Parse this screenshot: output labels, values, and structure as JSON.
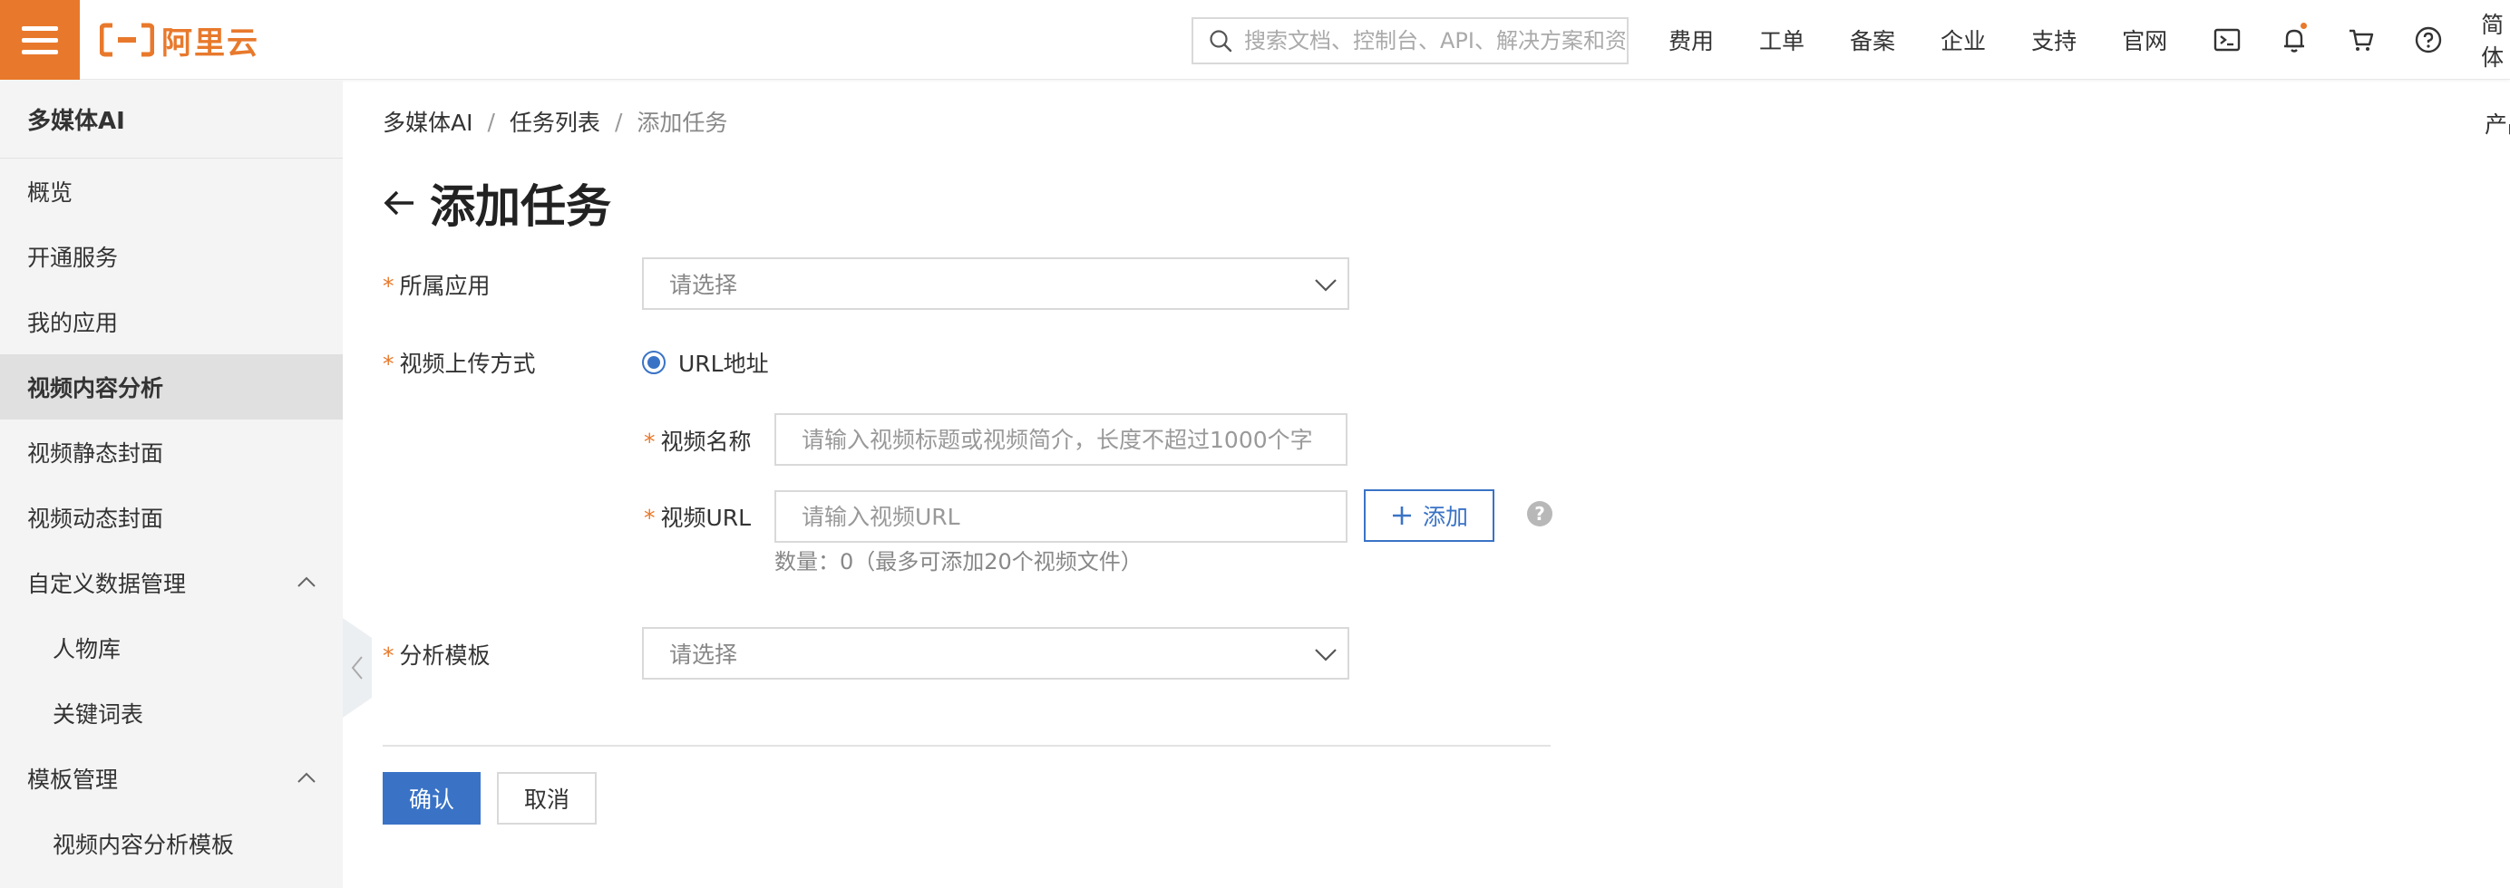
{
  "header": {
    "logo_text": "阿里云",
    "search_placeholder": "搜索文档、控制台、API、解决方案和资源",
    "links": [
      "费用",
      "工单",
      "备案",
      "企业",
      "支持",
      "官网"
    ],
    "icons": [
      "terminal-icon",
      "bell-icon",
      "cart-icon",
      "help-circle-icon"
    ],
    "lang": "简体",
    "accent_color": "#e8792c"
  },
  "sidebar": {
    "title": "多媒体AI",
    "items": [
      {
        "label": "概览"
      },
      {
        "label": "开通服务"
      },
      {
        "label": "我的应用"
      },
      {
        "label": "视频内容分析",
        "active": true
      },
      {
        "label": "视频静态封面"
      },
      {
        "label": "视频动态封面"
      },
      {
        "label": "自定义数据管理",
        "expanded": true
      },
      {
        "label": "人物库",
        "sub": true
      },
      {
        "label": "关键词表",
        "sub": true
      },
      {
        "label": "模板管理",
        "expanded": true
      },
      {
        "label": "视频内容分析模板",
        "sub": true
      }
    ]
  },
  "breadcrumb": [
    "多媒体AI",
    "任务列表",
    "添加任务"
  ],
  "breadcrumb_sep": "/",
  "edge_text": "产品",
  "page": {
    "title": "添加任务"
  },
  "form": {
    "required_mark": "*",
    "app_label": "所属应用",
    "app_placeholder": "请选择",
    "upload_label": "视频上传方式",
    "upload_option": "URL地址",
    "upload_selected": true,
    "video_name_label": "视频名称",
    "video_name_placeholder": "请输入视频标题或视频简介，长度不超过1000个字",
    "video_url_label": "视频URL",
    "video_url_placeholder": "请输入视频URL",
    "add_button": "添加",
    "help_glyph": "?",
    "hint": "数量：0（最多可添加20个视频文件）",
    "template_label": "分析模板",
    "template_placeholder": "请选择",
    "confirm_button": "确认",
    "cancel_button": "取消",
    "primary_color": "#3a73c6"
  }
}
